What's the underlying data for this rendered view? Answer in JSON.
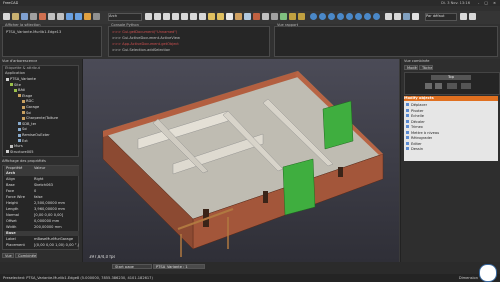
{
  "window": {
    "title": "FreeCAD",
    "clock": "Di. 3 Nov. 13:16",
    "controls": "– □ ×"
  },
  "menu": {
    "items": [
      "Fichier",
      "Édition",
      "Affichage",
      "Outils",
      "Macro",
      "Arch",
      "Draft",
      "Fenêtre",
      "Aide"
    ]
  },
  "toolbar": {
    "workbench": "Arch",
    "view_mode": "Par défaut"
  },
  "selection_panel": {
    "title": "Afficher la sélection",
    "content": "PTSA_Variante.Murlib1.Edge13"
  },
  "python_console": {
    "title": "Console Python",
    "lines": [
      ">>> Gui.getDocument(\"Unnamed\")",
      ">>> Gui.ActiveDocument.ActiveView",
      ">>> App.ActiveDocument.getObject",
      ">>> Gui.Selection.addSelection"
    ]
  },
  "report_panel": {
    "title": "Vue rapport"
  },
  "tree": {
    "title": "Vue d'arborescence",
    "header": "Étiquette & attribut",
    "section_app": "Application",
    "items": [
      {
        "label": "PTSA_Variante",
        "indent": 0,
        "color": "#d0d0d0"
      },
      {
        "label": "Site",
        "indent": 1,
        "color": "#9ac04a"
      },
      {
        "label": "Bâti",
        "indent": 2,
        "color": "#9ac04a"
      },
      {
        "label": "Étage",
        "indent": 3,
        "color": "#c8a060"
      },
      {
        "label": "RDC",
        "indent": 4,
        "color": "#c8a060"
      },
      {
        "label": "Garage",
        "indent": 4,
        "color": "#c8a060"
      },
      {
        "label": "Sol",
        "indent": 4,
        "color": "#c8a060"
      },
      {
        "label": "Charpente/Toiture",
        "indent": 4,
        "color": "#c8a060"
      },
      {
        "label": "SDB_ter",
        "indent": 3,
        "color": "#88aacc"
      },
      {
        "label": "Sol",
        "indent": 3,
        "color": "#88aacc"
      },
      {
        "label": "RemiseOuExter",
        "indent": 3,
        "color": "#88aacc"
      },
      {
        "label": "Ext",
        "indent": 3,
        "color": "#88aacc"
      },
      {
        "label": "Murs",
        "indent": 1,
        "color": "#c0c0c0"
      },
      {
        "label": "Structure005",
        "indent": 0,
        "color": "#d0d0d0"
      }
    ]
  },
  "properties": {
    "title": "Affichage des propriétés",
    "col_property": "Propriété",
    "col_value": "Valeur",
    "rows": [
      {
        "k": "Arch",
        "v": ""
      },
      {
        "k": "Align",
        "v": "Right"
      },
      {
        "k": "Base",
        "v": "Sketch063"
      },
      {
        "k": "Face",
        "v": "0"
      },
      {
        "k": "Force Wire",
        "v": "false"
      },
      {
        "k": "Height",
        "v": "2,500,00000 mm"
      },
      {
        "k": "Length",
        "v": "3,960,00000 mm"
      },
      {
        "k": "Normal",
        "v": "[0,00 0,00 0,00]"
      },
      {
        "k": "Offset",
        "v": "0,000000 mm"
      },
      {
        "k": "Width",
        "v": "200,00000 mm"
      },
      {
        "k": "Base",
        "v": ""
      },
      {
        "k": "Label",
        "v": "mBaseMurMurGarage"
      },
      {
        "k": "Placement",
        "v": "[(0,00 0,00 1,00) 0,00 °,(0,00...]"
      }
    ]
  },
  "viewport": {
    "coords": "397,8/4,0 fps"
  },
  "tasks": {
    "title": "Vue combinée",
    "tab_model": "Modèle",
    "tab_tasks": "Tâches",
    "view_value": "Top",
    "section": "Modify objects",
    "items": [
      "Déplacer",
      "Pivoter",
      "Échelle",
      "Décaler",
      "Trimex",
      "Mettre à niveau",
      "Rétrograder",
      "Éditer",
      "Dessin"
    ]
  },
  "bottom_tabs": [
    "Vue",
    "Combinée"
  ],
  "doc_tabs": [
    "Start page",
    "PTSA_Variante : 1"
  ],
  "status": {
    "text": "Preselected: PTSA_Variante.Murlib1.Edge8 (5.000000, 7855.386230, 4101.182617)",
    "right": "Dimension"
  }
}
